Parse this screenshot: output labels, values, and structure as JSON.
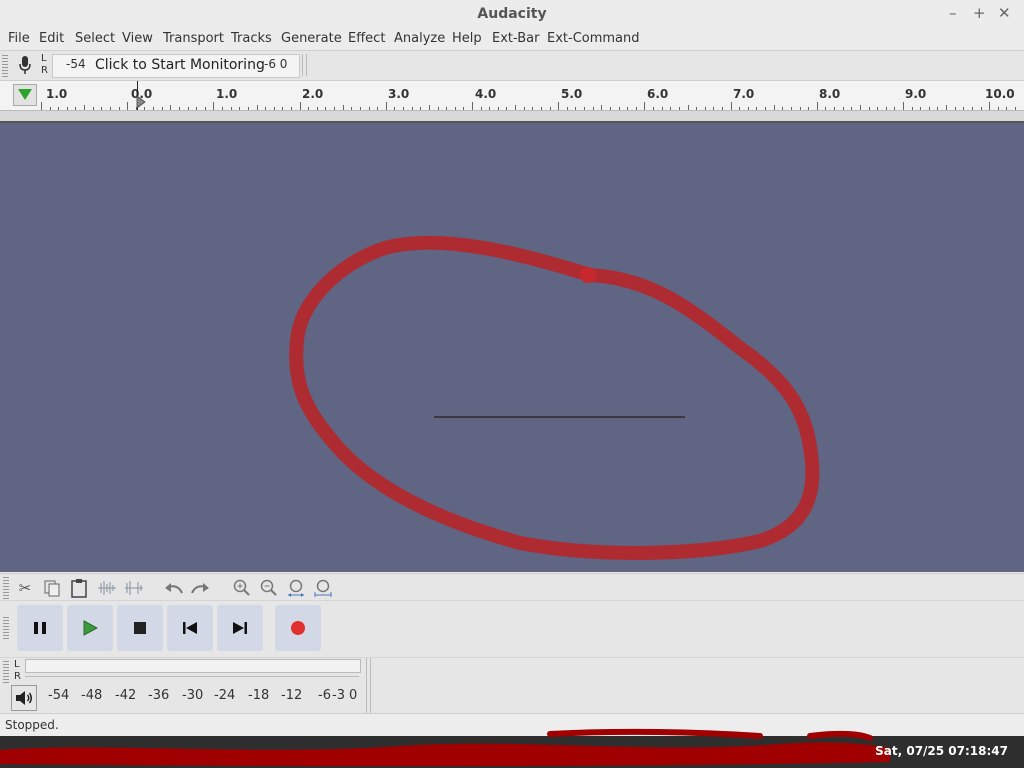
{
  "window": {
    "title": "Audacity",
    "controls": [
      "–",
      "+",
      "✕"
    ]
  },
  "menu": [
    "File",
    "Edit",
    "Select",
    "View",
    "Transport",
    "Tracks",
    "Generate",
    "Effect",
    "Analyze",
    "Help",
    "Ext-Bar",
    "Ext-Command"
  ],
  "record_meter": {
    "channels": [
      "L",
      "R"
    ],
    "left_value": "-54",
    "prompt": "Click to Start Monitoring",
    "right_value": "-6  0"
  },
  "timeline": {
    "labels": [
      "1.0",
      "0.0",
      "1.0",
      "2.0",
      "3.0",
      "4.0",
      "5.0",
      "6.0",
      "7.0",
      "8.0",
      "9.0",
      "10.0"
    ]
  },
  "transport": {
    "buttons": [
      "pause",
      "play",
      "stop",
      "skip-start",
      "skip-end",
      "record"
    ]
  },
  "play_meter": {
    "channels": [
      "L",
      "R"
    ],
    "scale": [
      "-54",
      "-48",
      "-42",
      "-36",
      "-30",
      "-24",
      "-18",
      "-12",
      "-6",
      "-3",
      "0"
    ]
  },
  "status": {
    "text": "Stopped."
  },
  "taskbar": {
    "clock": "Sat, 07/25 07:18:47"
  },
  "colors": {
    "track_bg": "#5f6582",
    "annotation": "#b5262b",
    "taskbar_scribble": "#a00000",
    "play_green": "#3c9a3c",
    "record_red": "#e03030"
  },
  "icons": [
    "mic-icon",
    "cut-icon",
    "copy-icon",
    "paste-icon",
    "trim-icon",
    "silence-icon",
    "undo-icon",
    "redo-icon",
    "zoom-in-icon",
    "zoom-out-icon",
    "fit-selection-icon",
    "fit-project-icon",
    "speaker-icon"
  ]
}
